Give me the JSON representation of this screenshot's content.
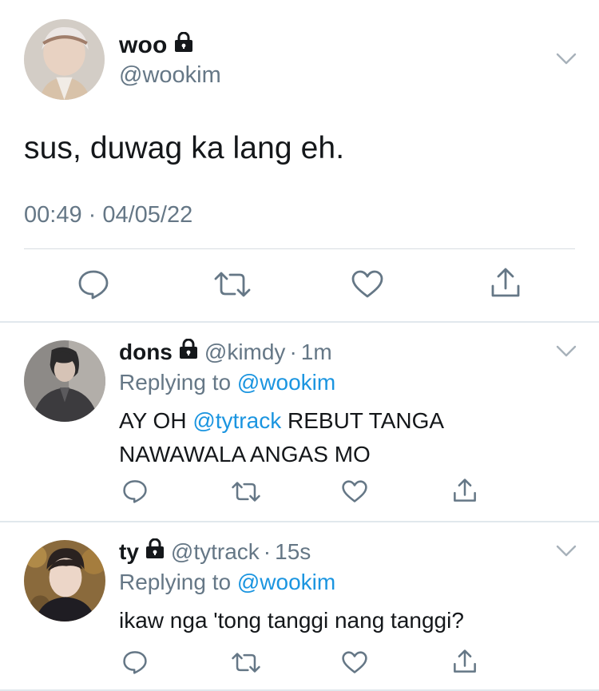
{
  "main_tweet": {
    "name": "woo",
    "handle": "@wookim",
    "text": "sus, duwag ka lang eh.",
    "timestamp": "00:49 · 04/05/22"
  },
  "replies": [
    {
      "name": "dons",
      "handle": "@kimdy",
      "dot": "·",
      "time": "1m",
      "replying_prefix": "Replying to",
      "replying_handle": "@wookim",
      "text_line1_prefix": "AY OH",
      "text_line1_mention": "@tytrack",
      "text_line1_suffix": "REBUT TANGA",
      "text_line2": "NAWAWALA ANGAS MO"
    },
    {
      "name": "ty",
      "handle": "@tytrack",
      "dot": "·",
      "time": "15s",
      "replying_prefix": "Replying to",
      "replying_handle": "@wookim",
      "text_line1": "ikaw nga 'tong tanggi nang tanggi?"
    }
  ],
  "icons": [
    "lock-icon",
    "chevron-down-icon",
    "reply-icon",
    "retweet-icon",
    "like-icon",
    "share-icon"
  ],
  "colors": {
    "text": "#14171a",
    "secondary": "#657786",
    "link": "#1b95e0",
    "divider": "#e1e8ed"
  }
}
